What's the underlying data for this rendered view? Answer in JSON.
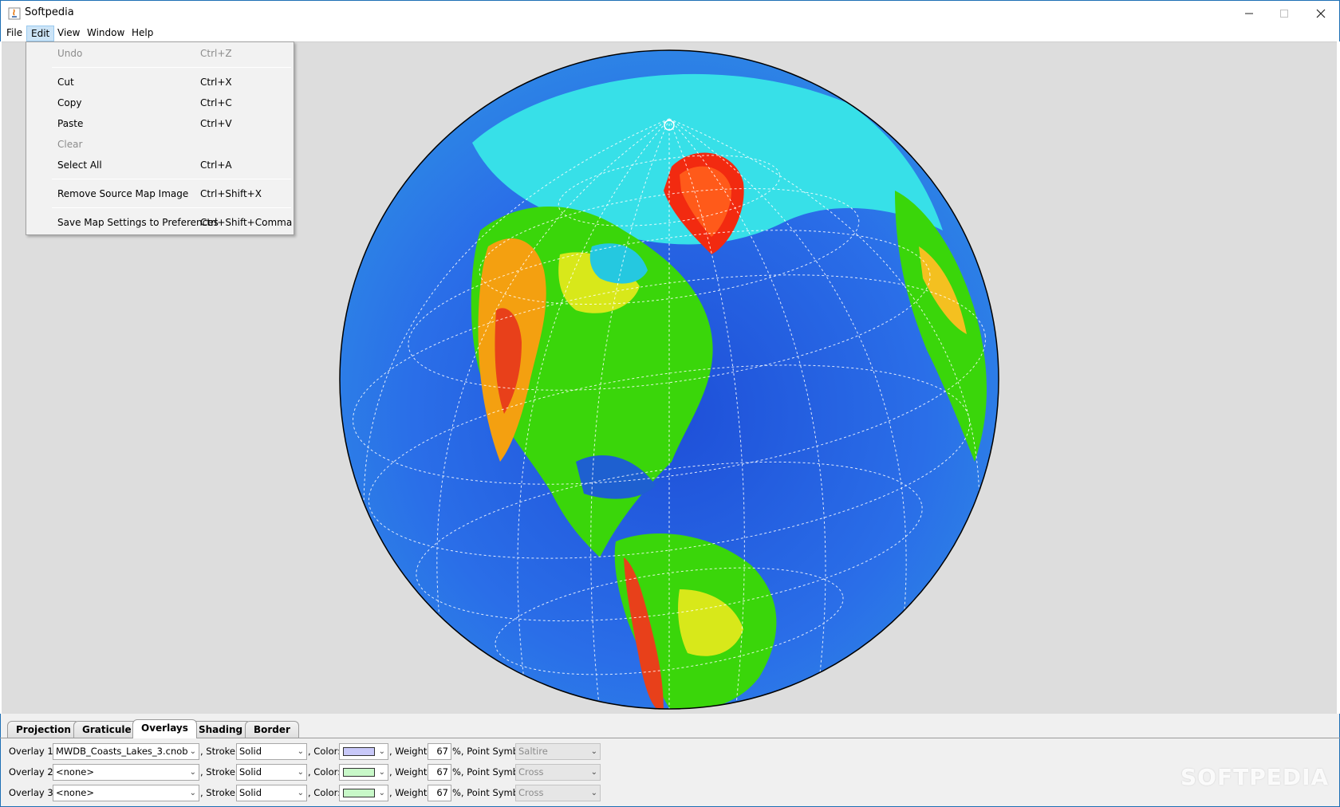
{
  "window": {
    "title": "Softpedia"
  },
  "menubar": {
    "items": [
      "File",
      "Edit",
      "View",
      "Window",
      "Help"
    ]
  },
  "edit_menu": {
    "items": [
      {
        "label": "Undo",
        "shortcut": "Ctrl+Z",
        "enabled": false
      },
      {
        "label": "Cut",
        "shortcut": "Ctrl+X",
        "enabled": true
      },
      {
        "label": "Copy",
        "shortcut": "Ctrl+C",
        "enabled": true
      },
      {
        "label": "Paste",
        "shortcut": "Ctrl+V",
        "enabled": true
      },
      {
        "label": "Clear",
        "shortcut": "",
        "enabled": false
      },
      {
        "label": "Select All",
        "shortcut": "Ctrl+A",
        "enabled": true
      },
      {
        "label": "Remove Source Map Image",
        "shortcut": "Ctrl+Shift+X",
        "enabled": true
      },
      {
        "label": "Save Map Settings to Preferences",
        "shortcut": "Ctrl+Shift+Comma",
        "enabled": true
      }
    ]
  },
  "tabs": [
    "Projection",
    "Graticule",
    "Overlays",
    "Shading",
    "Border"
  ],
  "selected_tab": "Overlays",
  "overlays": {
    "stroke_label": ", Stroke:",
    "color_label": ", Color:",
    "weight_label": ", Weight:",
    "point_label": "%, Point Symbol",
    "rows": [
      {
        "label": "Overlay 1:",
        "file": "MWDB_Coasts_Lakes_3.cnob",
        "stroke": "Solid",
        "color": "#c8c8f8",
        "weight": "67",
        "point_symbol": "Saltire"
      },
      {
        "label": "Overlay 2:",
        "file": "<none>",
        "stroke": "Solid",
        "color": "#c8f8c8",
        "weight": "67",
        "point_symbol": "Cross"
      },
      {
        "label": "Overlay 3:",
        "file": "<none>",
        "stroke": "Solid",
        "color": "#c8f8c8",
        "weight": "67",
        "point_symbol": "Cross"
      }
    ]
  },
  "watermark": "SOFTPEDIA",
  "colors": {
    "map_background": "#dddddd",
    "menu_highlight": "#cce4f7"
  }
}
